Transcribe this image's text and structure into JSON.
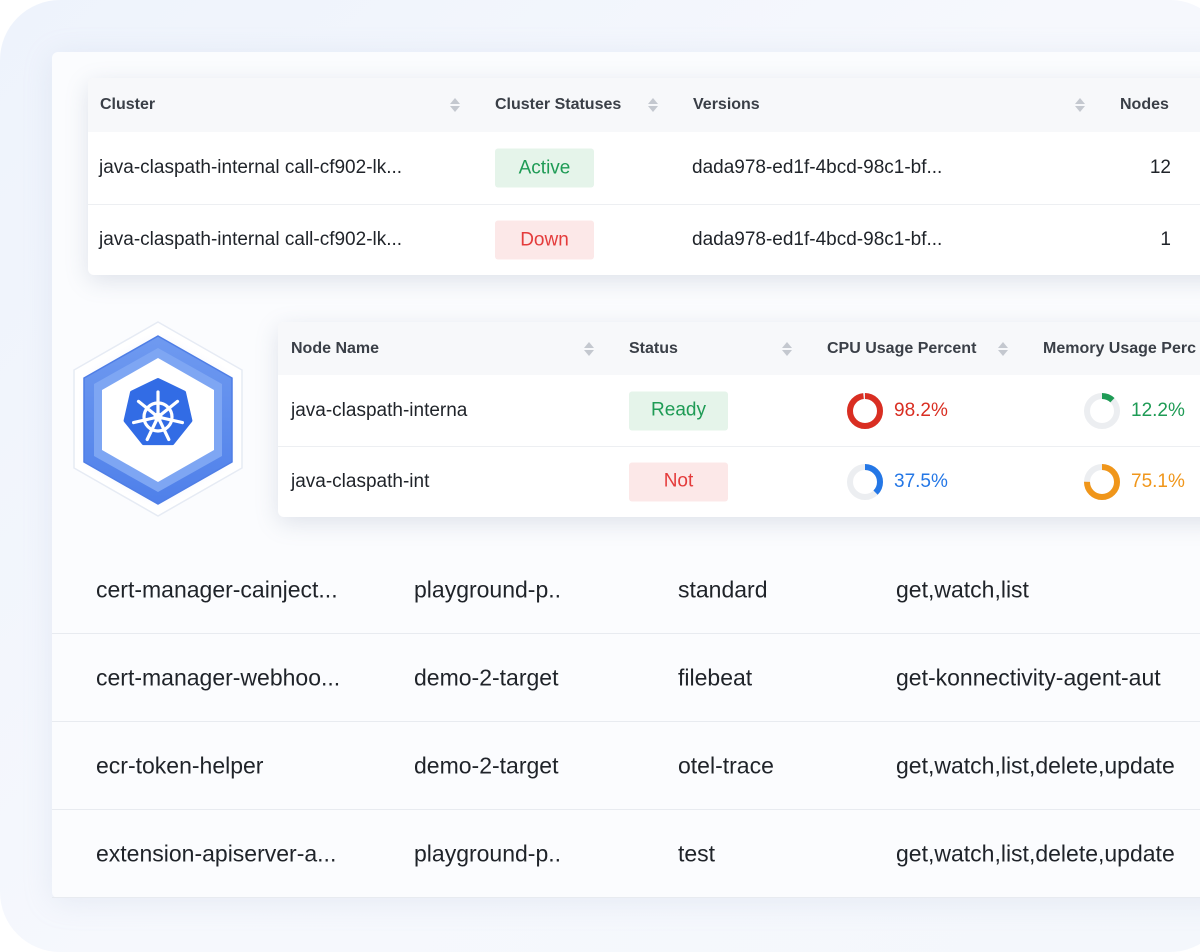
{
  "colors": {
    "accent_blue": "#326ce5",
    "status_green": "#1e9b55",
    "status_red": "#e43b3b",
    "usage_red": "#d92e22",
    "usage_green": "#1e9b55",
    "usage_blue": "#2477e6",
    "usage_orange": "#f0961a"
  },
  "logo": {
    "icon": "kubernetes-helm-icon"
  },
  "cluster_table": {
    "headers": [
      "Cluster",
      "Cluster Statuses",
      "Versions",
      "Nodes"
    ],
    "rows": [
      {
        "cluster": "java-claspath-internal call-cf902-lk...",
        "status": "Active",
        "status_color": "green",
        "version": "dada978-ed1f-4bcd-98c1-bf...",
        "nodes": "12"
      },
      {
        "cluster": "java-claspath-internal call-cf902-lk...",
        "status": "Down",
        "status_color": "red",
        "version": "dada978-ed1f-4bcd-98c1-bf...",
        "nodes": "1"
      }
    ]
  },
  "node_table": {
    "headers": [
      "Node Name",
      "Status",
      "CPU Usage Percent",
      "Memory Usage Perc"
    ],
    "rows": [
      {
        "name": "java-claspath-interna",
        "status": "Ready",
        "status_color": "green",
        "cpu": "98.2%",
        "cpu_value": 98.2,
        "cpu_color": "#d92e22",
        "memory": "12.2%",
        "memory_value": 12.2,
        "memory_color": "#1e9b55"
      },
      {
        "name": "java-claspath-int",
        "status": "Not",
        "status_color": "red",
        "cpu": "37.5%",
        "cpu_value": 37.5,
        "cpu_color": "#2477e6",
        "memory": "75.1%",
        "memory_value": 75.1,
        "memory_color": "#f0961a"
      }
    ]
  },
  "background_table": {
    "rows": [
      [
        "cert-manager-cainject...",
        "playground-p..",
        "standard",
        "get,watch,list"
      ],
      [
        "cert-manager-webhoo...",
        "demo-2-target",
        "filebeat",
        "get-konnectivity-agent-aut"
      ],
      [
        "ecr-token-helper",
        "demo-2-target",
        "otel-trace",
        "get,watch,list,delete,update"
      ],
      [
        "extension-apiserver-a...",
        "playground-p..",
        "test",
        "get,watch,list,delete,update"
      ]
    ]
  }
}
